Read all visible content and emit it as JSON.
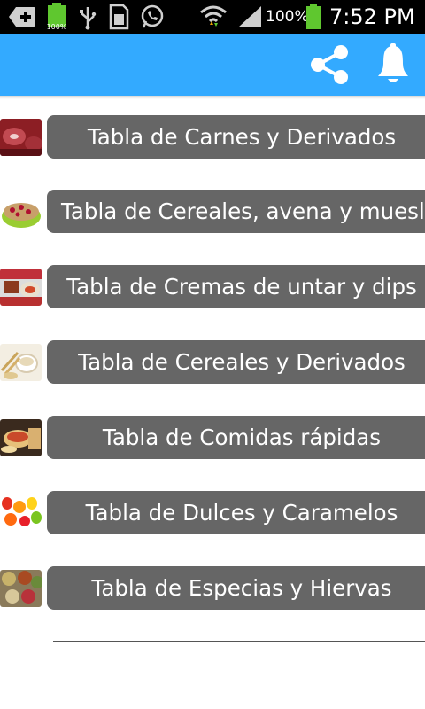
{
  "status_bar": {
    "battery_small_label": "100%",
    "battery_percent": "100%",
    "time": "7:52 PM"
  },
  "app_bar": {
    "background_color": "#33aaff",
    "actions": [
      "share-icon",
      "bell-icon"
    ]
  },
  "list": {
    "items": [
      {
        "label": "Tabla de Carnes y Derivados"
      },
      {
        "label": "Tabla de Cereales, avena y muesli"
      },
      {
        "label": "Tabla de Cremas de untar y dips"
      },
      {
        "label": "Tabla de Cereales y Derivados"
      },
      {
        "label": "Tabla de Comidas rápidas"
      },
      {
        "label": "Tabla de Dulces y Caramelos"
      },
      {
        "label": "Tabla de Especias y Hiervas"
      }
    ],
    "button_color": "#666666"
  }
}
